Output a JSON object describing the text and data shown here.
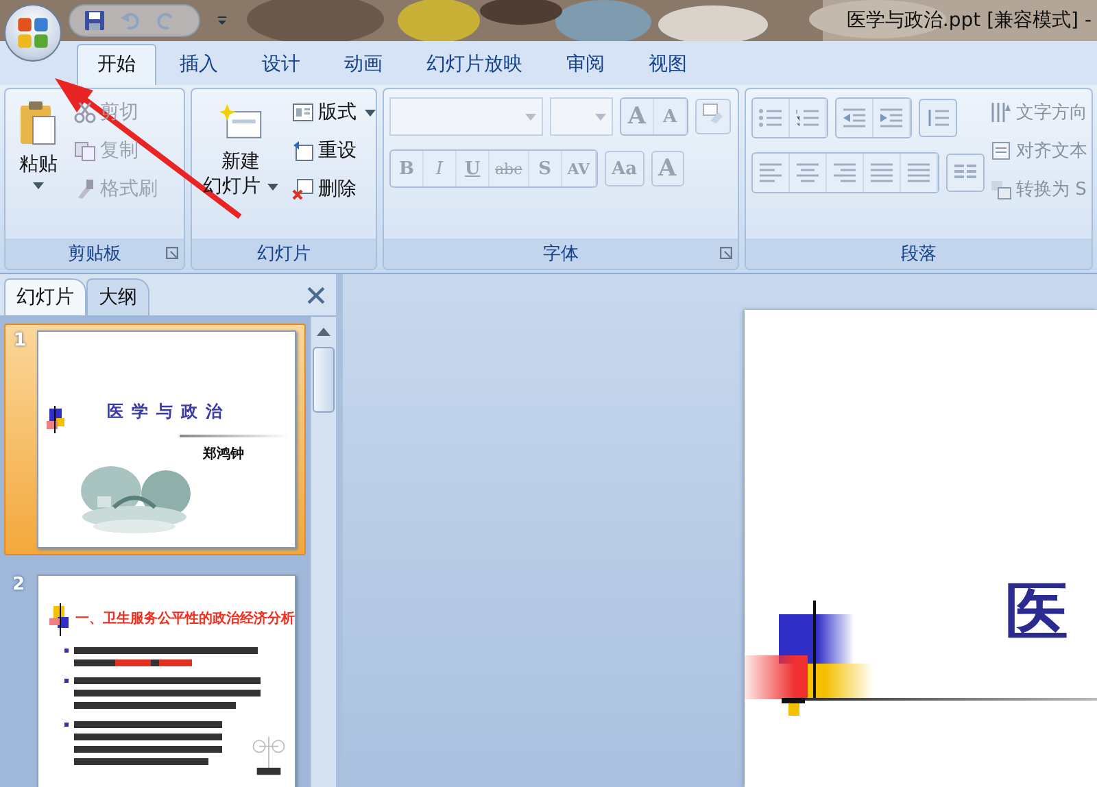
{
  "window": {
    "title": "医学与政治.ppt [兼容模式] -"
  },
  "ribbon_tabs": [
    {
      "label": "开始",
      "selected": true
    },
    {
      "label": "插入",
      "selected": false
    },
    {
      "label": "设计",
      "selected": false
    },
    {
      "label": "动画",
      "selected": false
    },
    {
      "label": "幻灯片放映",
      "selected": false
    },
    {
      "label": "审阅",
      "selected": false
    },
    {
      "label": "视图",
      "selected": false
    }
  ],
  "clipboard": {
    "label": "剪贴板",
    "paste": {
      "label": "粘贴",
      "disabled": false
    },
    "items": [
      {
        "label": "剪切",
        "kind": "cut",
        "disabled": true
      },
      {
        "label": "复制",
        "kind": "copy",
        "disabled": true
      },
      {
        "label": "格式刷",
        "kind": "brush",
        "disabled": true
      }
    ]
  },
  "slides_group": {
    "label": "幻灯片",
    "new_slide": [
      "新建",
      "幻灯片"
    ],
    "items": [
      {
        "label": "版式",
        "kind": "layout",
        "dropdown": true
      },
      {
        "label": "重设",
        "kind": "reset",
        "dropdown": false
      },
      {
        "label": "删除",
        "kind": "delete",
        "dropdown": false
      }
    ]
  },
  "font": {
    "label": "字体",
    "disabled": true,
    "size_buttons": [
      "A",
      "A"
    ],
    "format_buttons": [
      {
        "label": "B",
        "kind": "bold"
      },
      {
        "label": "I",
        "kind": "italic"
      },
      {
        "label": "U",
        "kind": "underline"
      },
      {
        "label": "abc",
        "kind": "strike"
      },
      {
        "label": "S",
        "kind": "shadow"
      },
      {
        "label": "AV",
        "kind": "spacing"
      },
      {
        "label": "Aa",
        "kind": "case"
      },
      {
        "label": "A",
        "kind": "color"
      }
    ]
  },
  "paragraph": {
    "label": "段落",
    "disabled": true,
    "side_items": [
      {
        "label": "文字方向",
        "kind": "direction"
      },
      {
        "label": "对齐文本",
        "kind": "align"
      },
      {
        "label": "转换为 S",
        "kind": "smartart"
      }
    ]
  },
  "pane_tabs": [
    {
      "label": "幻灯片",
      "selected": true
    },
    {
      "label": "大纲",
      "selected": false
    }
  ],
  "thumbnails": [
    {
      "number": "1",
      "selected": true,
      "kind": "title",
      "title": "医学与政治",
      "subtitle": "郑鸿钟"
    },
    {
      "number": "2",
      "selected": false,
      "kind": "content",
      "heading": "一、卫生服务公平性的政治经济分析"
    }
  ],
  "slide": {
    "title": "医"
  }
}
